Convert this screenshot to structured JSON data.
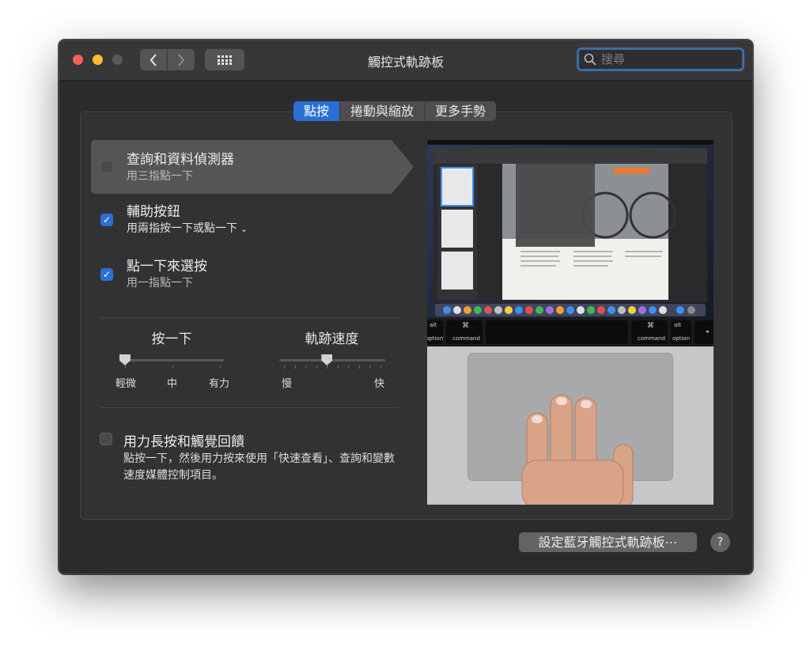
{
  "window": {
    "title": "觸控式軌跡板"
  },
  "search": {
    "placeholder": "搜尋"
  },
  "tabs": [
    {
      "label": "點按",
      "active": true
    },
    {
      "label": "捲動與縮放",
      "active": false
    },
    {
      "label": "更多手勢",
      "active": false
    }
  ],
  "options": [
    {
      "title": "查詢和資料偵測器",
      "subtitle": "用三指點一下",
      "checked": false,
      "selected": true
    },
    {
      "title": "輔助按鈕",
      "subtitle": "用兩指按一下或點一下",
      "checked": true,
      "selected": false,
      "has_dropdown": true
    },
    {
      "title": "點一下來選按",
      "subtitle": "用一指點一下",
      "checked": true,
      "selected": false
    }
  ],
  "click_slider": {
    "title": "按一下",
    "labels": [
      "輕微",
      "中",
      "有力"
    ],
    "value_index": 0,
    "steps": 3
  },
  "speed_slider": {
    "title": "軌跡速度",
    "min_label": "慢",
    "max_label": "快",
    "value_fraction": 0.45,
    "ticks": 10
  },
  "force_click": {
    "title": "用力長按和觸覺回饋",
    "description": "點按一下，然後用力按來使用「快速查看」、查詢和變數速度媒體控制項目。",
    "checked": false
  },
  "preview": {
    "keys": {
      "left_alt": "alt",
      "left_option": "option",
      "left_cmd_symbol": "⌘",
      "left_command": "command",
      "right_cmd_symbol": "⌘",
      "right_command": "command",
      "right_alt": "alt",
      "right_option": "option"
    }
  },
  "buttons": {
    "setup_bluetooth": "設定藍牙觸控式軌跡板⋯",
    "help": "?"
  },
  "colors": {
    "accent": "#2a6fd6",
    "window_bg": "#2b2b2d",
    "close": "#fe5f57",
    "minimize": "#febc2e"
  }
}
